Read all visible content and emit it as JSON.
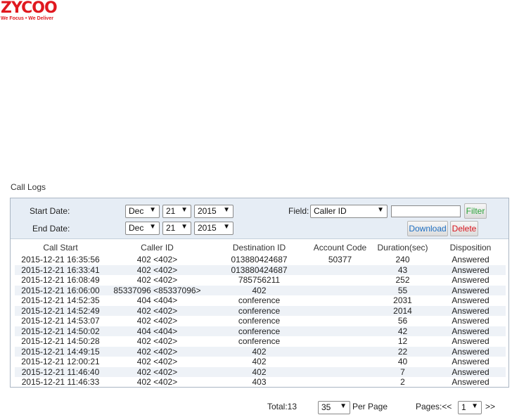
{
  "logo": {
    "word": "ZYCOO",
    "tagline": "We Focus • We Deliver"
  },
  "page": {
    "title": "Call Logs"
  },
  "filters": {
    "start_label": "Start Date:",
    "end_label": "End Date:",
    "start": {
      "month": "Dec",
      "day": "21",
      "year": "2015"
    },
    "end": {
      "month": "Dec",
      "day": "21",
      "year": "2015"
    },
    "field_label": "Field:",
    "field_value": "Caller ID",
    "filter_input_value": "",
    "filter_button": "Filter",
    "download_button": "Download",
    "delete_button": "Delete"
  },
  "table": {
    "headers": [
      "Call Start",
      "Caller ID",
      "Destination ID",
      "Account Code",
      "Duration(sec)",
      "Disposition"
    ],
    "rows": [
      [
        "2015-12-21 16:35:56",
        "402 <402>",
        "013880424687",
        "50377",
        "240",
        "Answered"
      ],
      [
        "2015-12-21 16:33:41",
        "402 <402>",
        "013880424687",
        "",
        "43",
        "Answered"
      ],
      [
        "2015-12-21 16:08:49",
        "402 <402>",
        "785756211",
        "",
        "252",
        "Answered"
      ],
      [
        "2015-12-21 16:06:00",
        "85337096 <85337096>",
        "402",
        "",
        "55",
        "Answered"
      ],
      [
        "2015-12-21 14:52:35",
        "404 <404>",
        "conference",
        "",
        "2031",
        "Answered"
      ],
      [
        "2015-12-21 14:52:49",
        "402 <402>",
        "conference",
        "",
        "2014",
        "Answered"
      ],
      [
        "2015-12-21 14:53:07",
        "402 <402>",
        "conference",
        "",
        "56",
        "Answered"
      ],
      [
        "2015-12-21 14:50:02",
        "404 <404>",
        "conference",
        "",
        "42",
        "Answered"
      ],
      [
        "2015-12-21 14:50:28",
        "402 <402>",
        "conference",
        "",
        "12",
        "Answered"
      ],
      [
        "2015-12-21 14:49:15",
        "402 <402>",
        "402",
        "",
        "22",
        "Answered"
      ],
      [
        "2015-12-21 12:00:21",
        "402 <402>",
        "402",
        "",
        "40",
        "Answered"
      ],
      [
        "2015-12-21 11:46:40",
        "402 <402>",
        "402",
        "",
        "7",
        "Answered"
      ],
      [
        "2015-12-21 11:46:33",
        "402 <402>",
        "403",
        "",
        "2",
        "Answered"
      ]
    ]
  },
  "footer": {
    "total": "Total:13",
    "per_page_value": "35",
    "per_page_label": "Per Page",
    "pages_label": "Pages:<<",
    "page_value": "1",
    "next": ">>"
  },
  "colors": {
    "brand": "#e0181f",
    "filter_green": "#2aa33a",
    "download_blue": "#1e6fc2",
    "delete_red": "#d8141c"
  }
}
